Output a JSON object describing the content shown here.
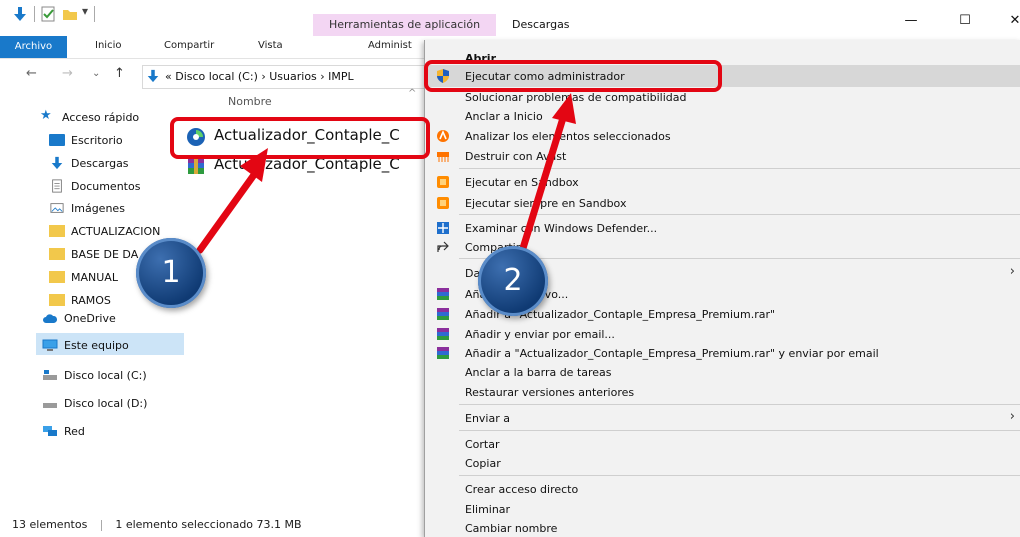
{
  "titlebar": {
    "context_tab": "Herramientas de aplicación",
    "title": "Descargas",
    "minimize": "—",
    "maximize": "☐",
    "close": "✕"
  },
  "ribbon": {
    "tabs": [
      "Archivo",
      "Inicio",
      "Compartir",
      "Vista",
      "Administ"
    ]
  },
  "address": {
    "path": "«  Disco local (C:)  ›  Usuarios  ›  IMPL"
  },
  "sidebar": {
    "items": [
      {
        "label": "Acceso rápido",
        "icon": "star-icon"
      },
      {
        "label": "Escritorio",
        "icon": "desktop-icon"
      },
      {
        "label": "Descargas",
        "icon": "download-icon"
      },
      {
        "label": "Documentos",
        "icon": "documents-icon"
      },
      {
        "label": "Imágenes",
        "icon": "images-icon"
      },
      {
        "label": "ACTUALIZACION",
        "icon": "folder-icon"
      },
      {
        "label": "BASE DE DA",
        "icon": "folder-icon"
      },
      {
        "label": "MANUAL",
        "icon": "folder-icon"
      },
      {
        "label": "RAMOS",
        "icon": "folder-icon"
      },
      {
        "label": "OneDrive",
        "icon": "cloud-icon"
      },
      {
        "label": "Este equipo",
        "icon": "computer-icon"
      },
      {
        "label": "Disco local (C:)",
        "icon": "drive-icon"
      },
      {
        "label": "Disco local (D:)",
        "icon": "drive-icon"
      },
      {
        "label": "Red",
        "icon": "network-icon"
      }
    ]
  },
  "filelist": {
    "column_name": "Nombre",
    "files": [
      {
        "name": "Actualizador_Contaple_C",
        "icon": "app-icon"
      },
      {
        "name": "Actualizador_Contaple_C",
        "icon": "winrar-icon"
      }
    ]
  },
  "status": {
    "count": "13 elementos",
    "selection": "1 elemento seleccionado  73.1 MB"
  },
  "context_menu": {
    "top_item": "Abrir",
    "items": [
      {
        "label": "Ejecutar como administrador",
        "icon": "shield-icon"
      },
      {
        "label": "Solucionar problemas de compatibilidad",
        "icon": ""
      },
      {
        "label": "Anclar a Inicio",
        "icon": ""
      },
      {
        "label": "Analizar los elementos seleccionados",
        "icon": "avast-icon"
      },
      {
        "label": "Destruir con Avast",
        "icon": "shredder-icon"
      },
      {
        "label": "Ejecutar en Sandbox",
        "icon": "sandbox-icon"
      },
      {
        "label": "Ejecutar siempre en Sandbox",
        "icon": "sandbox-icon"
      },
      {
        "label": "Examinar con Windows Defender...",
        "icon": "defender-icon"
      },
      {
        "label": "Compartir",
        "icon": "share-icon"
      },
      {
        "label": "Dar acceso a",
        "icon": ""
      },
      {
        "label": "Añadir al archivo...",
        "icon": "winrar-icon"
      },
      {
        "label": "Añadir a \"Actualizador_Contaple_Empresa_Premium.rar\"",
        "icon": "winrar-icon"
      },
      {
        "label": "Añadir y enviar por email...",
        "icon": "winrar-icon"
      },
      {
        "label": "Añadir a \"Actualizador_Contaple_Empresa_Premium.rar\" y enviar por email",
        "icon": "winrar-icon"
      },
      {
        "label": "Anclar a la barra de tareas",
        "icon": ""
      },
      {
        "label": "Restaurar versiones anteriores",
        "icon": ""
      },
      {
        "label": "Enviar a",
        "icon": ""
      },
      {
        "label": "Cortar",
        "icon": ""
      },
      {
        "label": "Copiar",
        "icon": ""
      },
      {
        "label": "Crear acceso directo",
        "icon": ""
      },
      {
        "label": "Eliminar",
        "icon": ""
      },
      {
        "label": "Cambiar nombre",
        "icon": ""
      }
    ]
  },
  "annotations": {
    "step1": "1",
    "step2": "2"
  },
  "colors": {
    "accent": "#1979ca",
    "highlight_red": "#e30613",
    "badge_blue": "#0f3a73",
    "context_tab": "#f3d6f3"
  }
}
